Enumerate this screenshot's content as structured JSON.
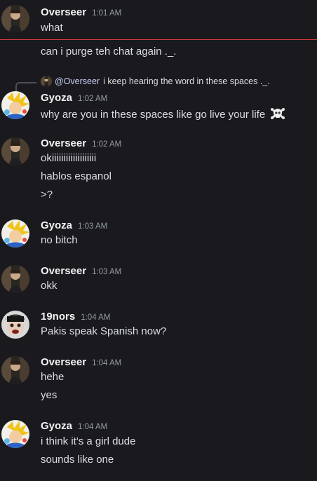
{
  "colors": {
    "background": "#1a1a1e",
    "new_messages_divider": "#d83a42",
    "username": "#f2f3f5",
    "timestamp": "#949ba4",
    "mention": "#c9cdfb"
  },
  "messages": [
    {
      "author": "Overseer",
      "timestamp": "1:01 AM",
      "avatar": "overseer-avatar",
      "lines": [
        "what",
        "can i purge teh chat again ._."
      ]
    },
    {
      "author": "Gyoza",
      "timestamp": "1:02 AM",
      "avatar": "gyoza-avatar",
      "reply": {
        "mention": "@Overseer",
        "text": "i keep hearing the word in these spaces ._."
      },
      "lines": [
        "why are you in these spaces like go live your life"
      ],
      "emoji": "skull-crossbones-icon"
    },
    {
      "author": "Overseer",
      "timestamp": "1:02 AM",
      "avatar": "overseer-avatar",
      "lines": [
        "okiiiiiiiiiiiiiiiiiii",
        "hablos espanol",
        ">?"
      ]
    },
    {
      "author": "Gyoza",
      "timestamp": "1:03 AM",
      "avatar": "gyoza-avatar",
      "lines": [
        "no bitch"
      ]
    },
    {
      "author": "Overseer",
      "timestamp": "1:03 AM",
      "avatar": "overseer-avatar",
      "lines": [
        "okk"
      ]
    },
    {
      "author": "19nors",
      "timestamp": "1:04 AM",
      "avatar": "19nors-avatar",
      "lines": [
        "Pakis speak Spanish now?"
      ]
    },
    {
      "author": "Overseer",
      "timestamp": "1:04 AM",
      "avatar": "overseer-avatar",
      "lines": [
        "hehe",
        "yes"
      ]
    },
    {
      "author": "Gyoza",
      "timestamp": "1:04 AM",
      "avatar": "gyoza-avatar",
      "lines": [
        "i think it's a girl dude",
        "sounds like one"
      ]
    }
  ]
}
